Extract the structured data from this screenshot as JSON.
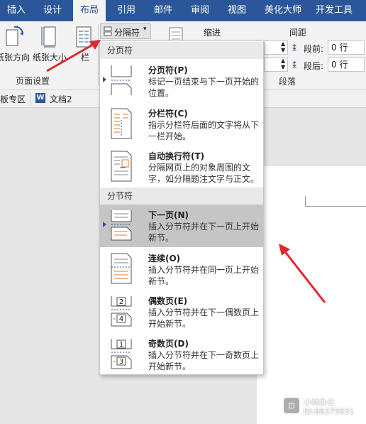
{
  "tabs": [
    "插入",
    "设计",
    "布局",
    "引用",
    "邮件",
    "审阅",
    "视图",
    "美化大师",
    "开发工具"
  ],
  "active_tab": "布局",
  "ribbon": {
    "orientation_label": "纸张方向",
    "size_label": "纸张大小",
    "columns_label": "栏",
    "page_setup_label": "页面设置",
    "breaks_button": "分隔符",
    "indent_label": "缩进",
    "spacing_label": "间距",
    "before_label": "段前:",
    "before_value": "0 行",
    "after_label": "段后:",
    "after_value": "0 行",
    "paragraph_label": "段落"
  },
  "doc_strip": {
    "zone_label": "板专区",
    "doc_name": "文档2"
  },
  "menu": {
    "page_breaks_header": "分页符",
    "section_breaks_header": "分节符",
    "items": [
      {
        "title": "分页符(P)",
        "desc": "标记一页结束与下一页开始的位置。",
        "icon": "page-break-icon"
      },
      {
        "title": "分栏符(C)",
        "desc": "指示分栏符后面的文字将从下一栏开始。",
        "icon": "column-break-icon"
      },
      {
        "title": "自动换行符(T)",
        "desc": "分隔网页上的对象周围的文字，如分隔题注文字与正文。",
        "icon": "text-wrapping-break-icon"
      },
      {
        "title": "下一页(N)",
        "desc": "插入分节符并在下一页上开始新节。",
        "icon": "next-page-icon"
      },
      {
        "title": "连续(O)",
        "desc": "插入分节符并在同一页上开始新节。",
        "icon": "continuous-icon"
      },
      {
        "title": "偶数页(E)",
        "desc": "插入分节符并在下一偶数页上开始新节。",
        "icon": "even-page-icon"
      },
      {
        "title": "奇数页(D)",
        "desc": "插入分节符并在下一奇数页上开始新节。",
        "icon": "odd-page-icon"
      }
    ]
  },
  "watermark": {
    "line1": "小林办公",
    "line2": "ID:68375931"
  },
  "colors": {
    "ribbon_blue": "#2b579a",
    "arrow_red": "#e0282e",
    "highlight": "#c5c5c5"
  }
}
